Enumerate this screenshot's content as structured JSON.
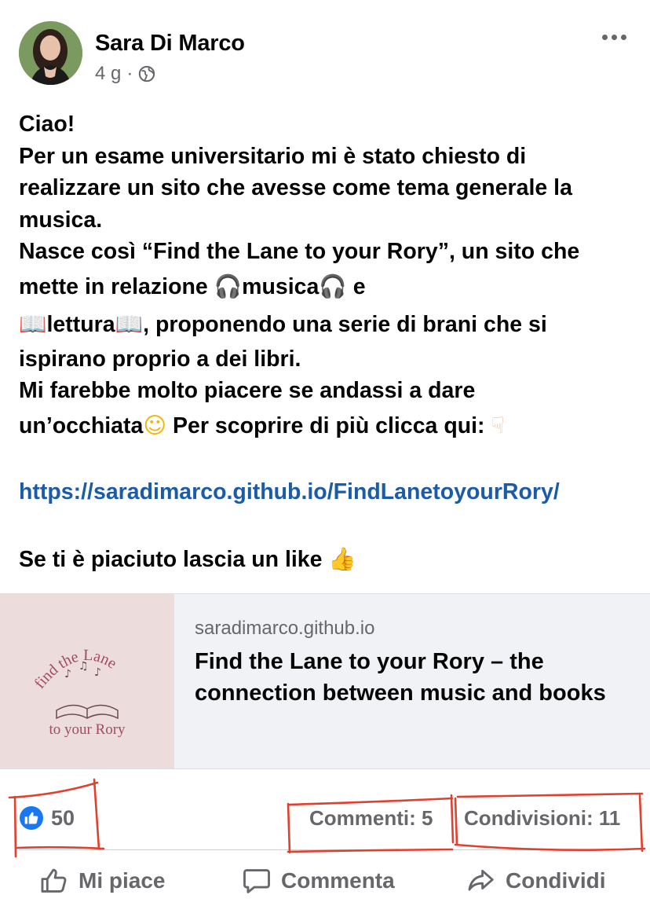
{
  "post": {
    "author": "Sara Di Marco",
    "time": "4 g",
    "separator": "·",
    "lines": [
      "Ciao!",
      "Per un esame universitario mi è stato chiesto di",
      "realizzare un sito che avesse come tema generale la",
      "musica.",
      "Nasce così “Find the Lane to your Rory”, un sito che"
    ],
    "line_music_prefix": "mette in relazione ",
    "music_word": "musica",
    "line_music_suffix": " e",
    "reading_word": "lettura",
    "line_reading_suffix": ", proponendo una serie di brani che si",
    "line_after_reading": "ispirano proprio a dei libri.",
    "line_pleasure": "Mi farebbe molto piacere se andassi a dare",
    "line_look": "un’occhiata",
    "line_discover": " Per scoprire di più clicca qui: ",
    "link": "https://saradimarco.github.io/FindLanetoyourRory/",
    "closing": "Se ti è piaciuto lascia un like "
  },
  "emoji": {
    "headphones": "🎧",
    "book": "📖",
    "smile": "☺",
    "point_down": "☟",
    "thumbs_up": "👍"
  },
  "preview": {
    "domain": "saradimarco.github.io",
    "title": "Find the Lane to your Rory – the connection between music and books",
    "image_text_top": "find the Lane",
    "image_text_bottom": "to your Rory"
  },
  "stats": {
    "likes": "50",
    "comments": "Commenti: 5",
    "shares": "Condivisioni: 11"
  },
  "actions": {
    "like": "Mi piace",
    "comment": "Commenta",
    "share": "Condividi"
  },
  "colors": {
    "link": "#1b5ba8",
    "secondary_text": "#65676b",
    "like_blue": "#1877f2",
    "annotation_red": "#e0402e"
  }
}
